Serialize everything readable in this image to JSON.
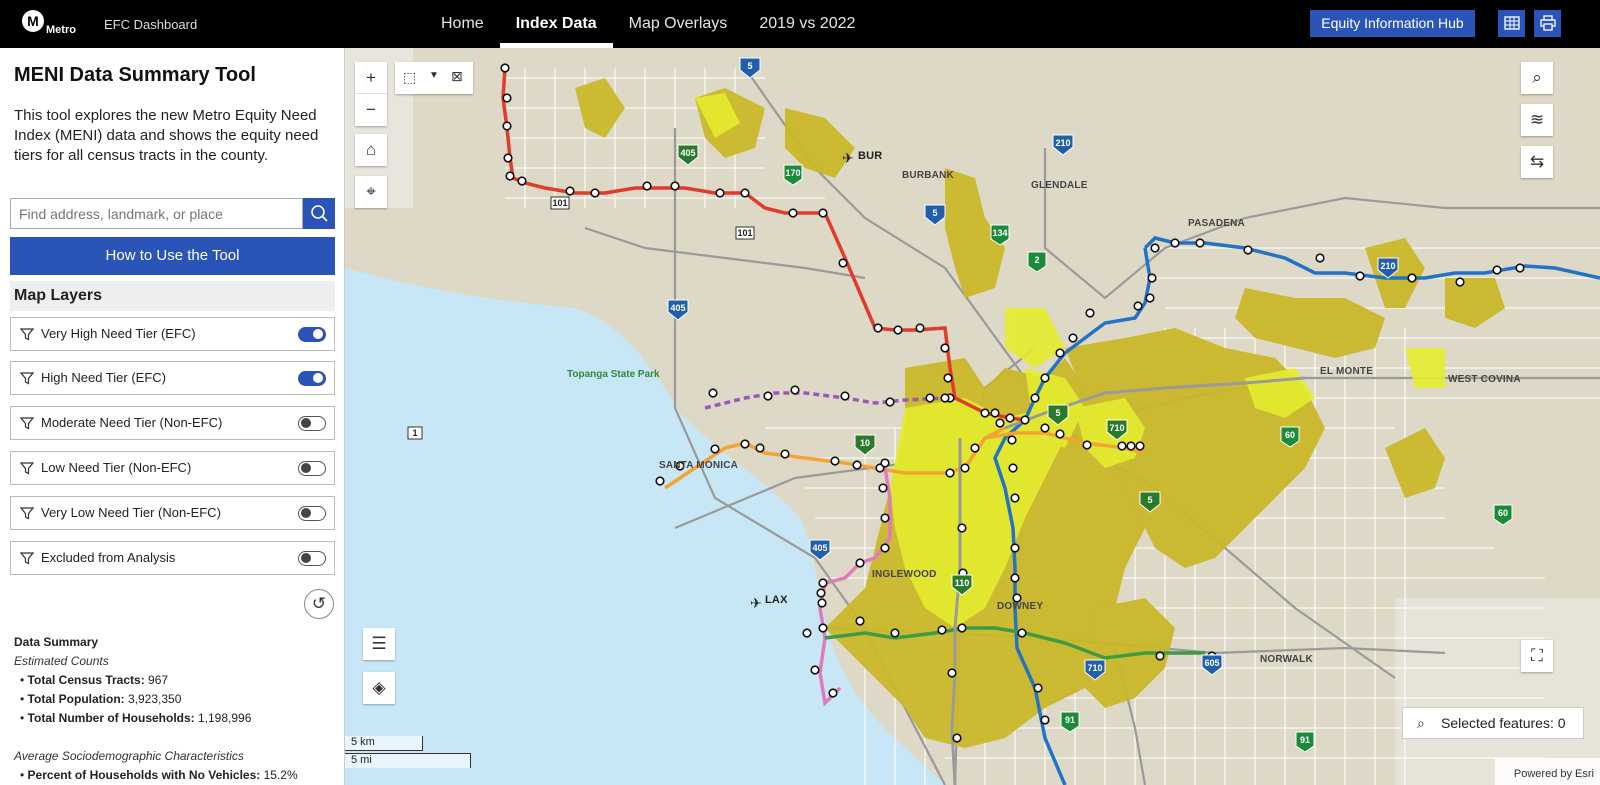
{
  "header": {
    "logo_letter": "M",
    "logo_text": "Metro",
    "app_title": "EFC Dashboard",
    "nav": [
      {
        "label": "Home",
        "active": false
      },
      {
        "label": "Index Data",
        "active": true
      },
      {
        "label": "Map Overlays",
        "active": false
      },
      {
        "label": "2019 vs 2022",
        "active": false
      }
    ],
    "hub_button": "Equity Information Hub",
    "icons": [
      "table-icon",
      "print-icon"
    ]
  },
  "sidebar": {
    "title": "MENI Data Summary Tool",
    "description": "This tool explores the new Metro Equity Need Index (MENI) data and shows the equity need tiers for all census tracts in the county.",
    "search_placeholder": "Find address, landmark, or place",
    "how_to_button": "How to Use the Tool",
    "layers_header": "Map Layers",
    "layers": [
      {
        "label": "Very High Need Tier (EFC)",
        "on": true
      },
      {
        "label": "High Need Tier (EFC)",
        "on": true
      },
      {
        "label": "Moderate Need Tier (Non-EFC)",
        "on": false
      },
      {
        "label": "Low Need Tier (Non-EFC)",
        "on": false
      },
      {
        "label": "Very Low Need Tier (Non-EFC)",
        "on": false
      },
      {
        "label": "Excluded from Analysis",
        "on": false
      }
    ],
    "summary": {
      "heading": "Data Summary",
      "counts_label": "Estimated Counts",
      "counts": [
        {
          "label": "Total Census Tracts:",
          "value": "967"
        },
        {
          "label": "Total Population:",
          "value": "3,923,350"
        },
        {
          "label": "Total Number of Households:",
          "value": "1,198,996"
        }
      ],
      "socio_label": "Average Sociodemographic Characteristics",
      "socio": [
        {
          "label": "Percent of Households with No Vehicles:",
          "value": "15.2%"
        }
      ]
    }
  },
  "map": {
    "places": [
      "BURBANK",
      "GLENDALE",
      "PASADENA",
      "EL MONTE",
      "WEST COVINA",
      "SANTA MONICA",
      "INGLEWOOD",
      "DOWNEY",
      "NORWALK"
    ],
    "airports": [
      "BUR",
      "LAX"
    ],
    "park": "Topanga State Park",
    "selected_features_label": "Selected features: 0",
    "scale_km": "5 km",
    "scale_mi": "5 mi",
    "attribution": "Powered by Esri",
    "highways": [
      "5",
      "405",
      "170",
      "101",
      "210",
      "134",
      "2",
      "10",
      "110",
      "710",
      "60",
      "605",
      "91",
      "1"
    ],
    "colors": {
      "very_high": "#c9b82a",
      "high": "#e4ec2e",
      "water": "#c7e7f7",
      "land": "#ddd9c6",
      "accent": "#2a54b8"
    }
  }
}
